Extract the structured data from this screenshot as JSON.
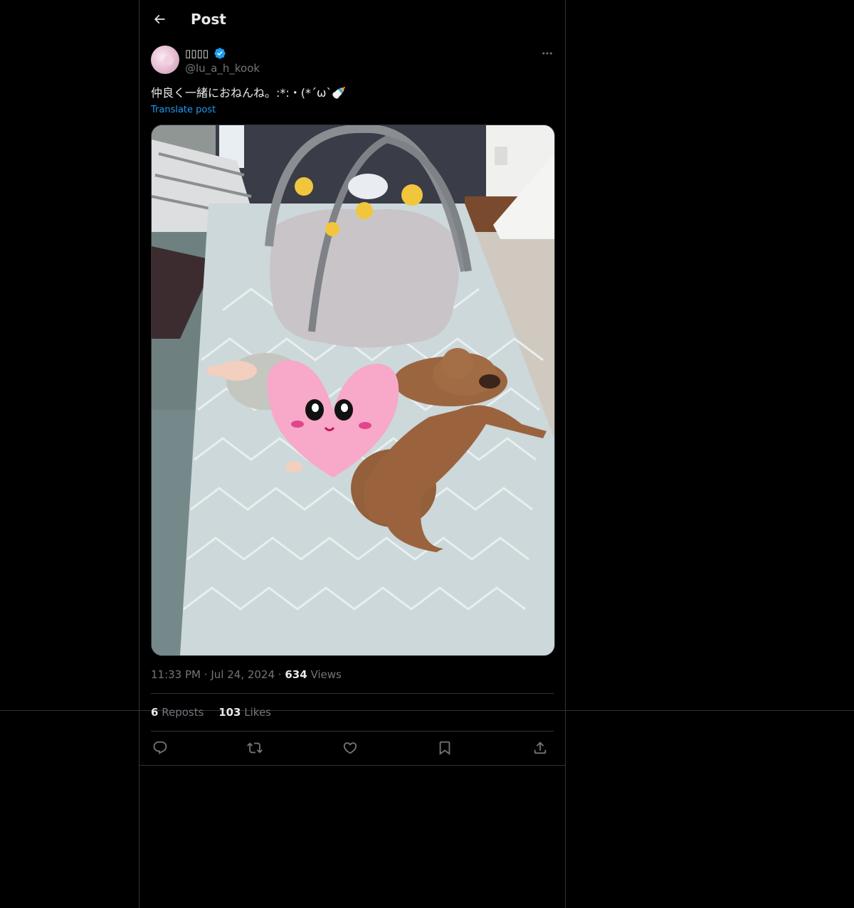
{
  "header": {
    "title": "Post",
    "back_icon": "arrow-left-icon"
  },
  "author": {
    "display_name": "▯▯▯▯",
    "handle": "@lu_a_h_kook",
    "verified": true,
    "verified_color": "#1d9bf0",
    "more_icon": "more-horizontal-icon"
  },
  "post": {
    "text": "仲良く一緒におねんね。:*:・(*´ω`🍼",
    "translate_label": "Translate post",
    "media_icon": "photo"
  },
  "meta": {
    "time": "11:33 PM",
    "separator": "·",
    "date": "Jul 24, 2024",
    "views_count": "634",
    "views_label": "Views"
  },
  "stats": {
    "reposts_count": "6",
    "reposts_label": "Reposts",
    "likes_count": "103",
    "likes_label": "Likes"
  },
  "actions": {
    "reply_icon": "reply-icon",
    "repost_icon": "repost-icon",
    "like_icon": "heart-icon",
    "bookmark_icon": "bookmark-icon",
    "share_icon": "share-icon"
  },
  "colors": {
    "background": "#000000",
    "text_primary": "#e7e9ea",
    "text_secondary": "#71767b",
    "link": "#1d9bf0",
    "border": "#2f3336"
  }
}
